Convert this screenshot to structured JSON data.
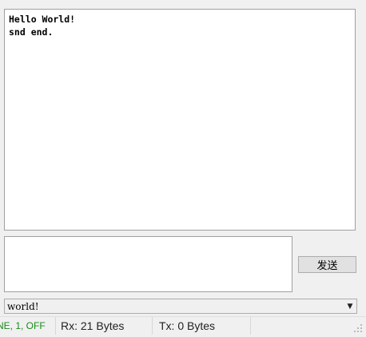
{
  "receive": {
    "lines": [
      "Hello World!",
      "snd end."
    ]
  },
  "send": {
    "value": "",
    "button_label": "发送"
  },
  "history": {
    "selected": "world!"
  },
  "status": {
    "port_settings": "NE, 1, OFF",
    "rx": "Rx: 21 Bytes",
    "tx": "Tx: 0 Bytes",
    "extra": ""
  },
  "icons": {
    "combo_arrow": "chevron-down-icon",
    "size_grip": "size-grip-icon"
  },
  "colors": {
    "port_status_text": "#1a8a1a"
  }
}
